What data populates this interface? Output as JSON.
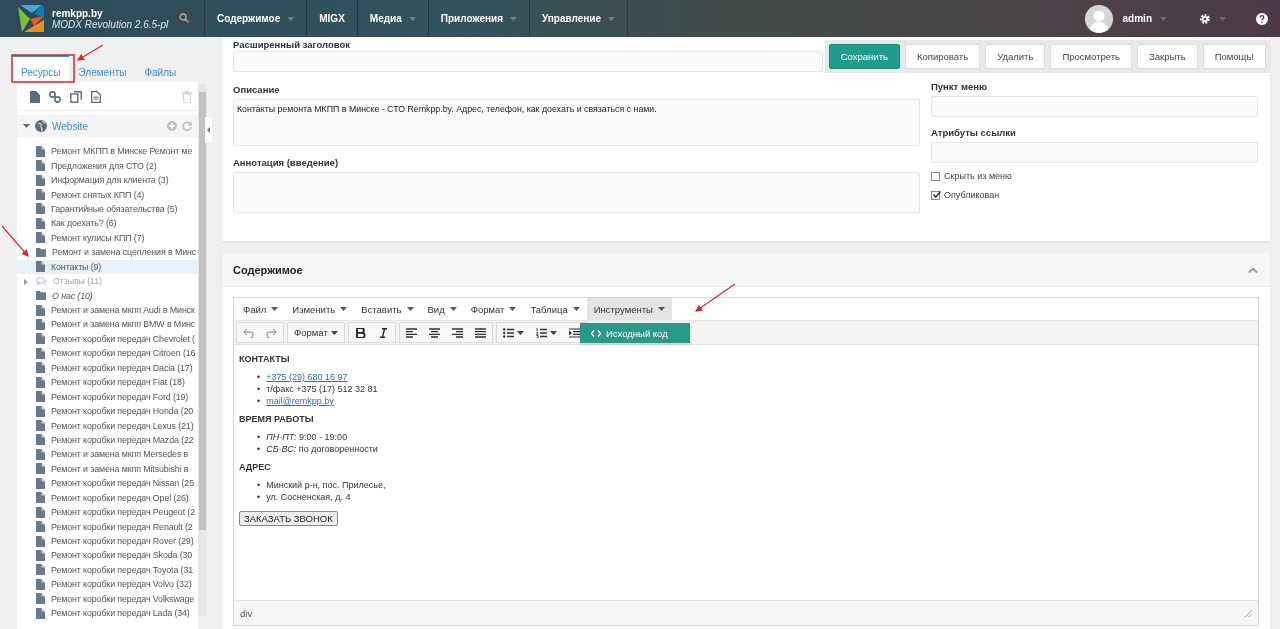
{
  "topbar": {
    "site_name": "remkpp.by",
    "version": "MODX Revolution 2.6.5-pl",
    "user": "admin",
    "nav": [
      {
        "label": "Содержимое",
        "has_menu": true
      },
      {
        "label": "MIGX",
        "has_menu": false
      },
      {
        "label": "Медиа",
        "has_menu": true
      },
      {
        "label": "Приложения",
        "has_menu": true
      },
      {
        "label": "Управление",
        "has_menu": true
      }
    ]
  },
  "sidebar": {
    "tabs": [
      {
        "label": "Ресурсы",
        "selected": true
      },
      {
        "label": "Элементы",
        "selected": false
      },
      {
        "label": "Файлы",
        "selected": false
      }
    ],
    "root": "Website",
    "items": [
      {
        "label": "Ремонт МКПП в Минске Ремонт ме",
        "kind": "document",
        "selected": false,
        "published": true,
        "hidden_from_menu": false,
        "expandable": false
      },
      {
        "label": "Предложения для СТО (2)",
        "kind": "document",
        "selected": false,
        "published": true,
        "hidden_from_menu": false,
        "expandable": false
      },
      {
        "label": "Информация для клиента (3)",
        "kind": "document",
        "selected": false,
        "published": true,
        "hidden_from_menu": false,
        "expandable": false
      },
      {
        "label": "Ремонт снятых КПП (4)",
        "kind": "document",
        "selected": false,
        "published": true,
        "hidden_from_menu": false,
        "expandable": false
      },
      {
        "label": "Гарантийные обязательства (5)",
        "kind": "document",
        "selected": false,
        "published": true,
        "hidden_from_menu": false,
        "expandable": false
      },
      {
        "label": "Как доехать? (6)",
        "kind": "document",
        "selected": false,
        "published": true,
        "hidden_from_menu": false,
        "expandable": false
      },
      {
        "label": "Ремонт кулисы КПП (7)",
        "kind": "document",
        "selected": false,
        "published": true,
        "hidden_from_menu": false,
        "expandable": false
      },
      {
        "label": "Ремонт и замена сцепления в Минс",
        "kind": "folder",
        "selected": false,
        "published": true,
        "hidden_from_menu": false,
        "expandable": false
      },
      {
        "label": "Контакты (9)",
        "kind": "document",
        "selected": true,
        "published": true,
        "hidden_from_menu": false,
        "expandable": false
      },
      {
        "label": "Отзывы (11)",
        "kind": "comments",
        "selected": false,
        "published": false,
        "hidden_from_menu": false,
        "expandable": true
      },
      {
        "label": "О нас (10)",
        "kind": "folder",
        "selected": false,
        "published": true,
        "hidden_from_menu": true,
        "expandable": false
      },
      {
        "label": "Ремонт и замена мкпп Audi в Минск",
        "kind": "document",
        "selected": false,
        "published": true,
        "hidden_from_menu": false,
        "expandable": false
      },
      {
        "label": "Ремонт и замена мкпп BMW в Минс",
        "kind": "document",
        "selected": false,
        "published": true,
        "hidden_from_menu": false,
        "expandable": false
      },
      {
        "label": "Ремонт коробки передач Chevrolet (",
        "kind": "document",
        "selected": false,
        "published": true,
        "hidden_from_menu": false,
        "expandable": false
      },
      {
        "label": "Ремонт коробки передач Citroen (16",
        "kind": "document",
        "selected": false,
        "published": true,
        "hidden_from_menu": false,
        "expandable": false
      },
      {
        "label": "Ремонт коробки передач Dacia (17)",
        "kind": "document",
        "selected": false,
        "published": true,
        "hidden_from_menu": false,
        "expandable": false
      },
      {
        "label": "Ремонт коробки передач Fiat (18)",
        "kind": "document",
        "selected": false,
        "published": true,
        "hidden_from_menu": false,
        "expandable": false
      },
      {
        "label": "Ремонт коробки передач Ford (19)",
        "kind": "document",
        "selected": false,
        "published": true,
        "hidden_from_menu": false,
        "expandable": false
      },
      {
        "label": "Ремонт коробки передач Honda (20",
        "kind": "document",
        "selected": false,
        "published": true,
        "hidden_from_menu": false,
        "expandable": false
      },
      {
        "label": "Ремонт коробки передач Lexus (21)",
        "kind": "document",
        "selected": false,
        "published": true,
        "hidden_from_menu": false,
        "expandable": false
      },
      {
        "label": "Ремонт коробки передач Mazda (22",
        "kind": "document",
        "selected": false,
        "published": true,
        "hidden_from_menu": false,
        "expandable": false
      },
      {
        "label": "Ремонт и замена мкпп Mersedes в",
        "kind": "document",
        "selected": false,
        "published": true,
        "hidden_from_menu": false,
        "expandable": false
      },
      {
        "label": "Ремонт и замена мкпп Mitsubishi в",
        "kind": "document",
        "selected": false,
        "published": true,
        "hidden_from_menu": false,
        "expandable": false
      },
      {
        "label": "Ремонт коробки передач Nissan (25",
        "kind": "document",
        "selected": false,
        "published": true,
        "hidden_from_menu": false,
        "expandable": false
      },
      {
        "label": "Ремонт коробки передач Opel (26)",
        "kind": "document",
        "selected": false,
        "published": true,
        "hidden_from_menu": false,
        "expandable": false
      },
      {
        "label": "Ремонт коробки передач Peugeot (2",
        "kind": "document",
        "selected": false,
        "published": true,
        "hidden_from_menu": false,
        "expandable": false
      },
      {
        "label": "Ремонт коробки передач Renault (2",
        "kind": "document",
        "selected": false,
        "published": true,
        "hidden_from_menu": false,
        "expandable": false
      },
      {
        "label": "Ремонт коробки передач Rover (29)",
        "kind": "document",
        "selected": false,
        "published": true,
        "hidden_from_menu": false,
        "expandable": false
      },
      {
        "label": "Ремонт коробки передач Skoda (30",
        "kind": "document",
        "selected": false,
        "published": true,
        "hidden_from_menu": false,
        "expandable": false
      },
      {
        "label": "Ремонт коробки передач Toyota (31",
        "kind": "document",
        "selected": false,
        "published": true,
        "hidden_from_menu": false,
        "expandable": false
      },
      {
        "label": "Ремонт коробки передач Volvo (32)",
        "kind": "document",
        "selected": false,
        "published": true,
        "hidden_from_menu": false,
        "expandable": false
      },
      {
        "label": "Ремонт коробки передач Volkswage",
        "kind": "document",
        "selected": false,
        "published": true,
        "hidden_from_menu": false,
        "expandable": false
      },
      {
        "label": "Ремонт коробки передач Lada (34)",
        "kind": "document",
        "selected": false,
        "published": true,
        "hidden_from_menu": false,
        "expandable": false
      }
    ]
  },
  "actions": [
    {
      "label": "Сохранить",
      "primary": true
    },
    {
      "label": "Копировать",
      "primary": false
    },
    {
      "label": "Удалить",
      "primary": false
    },
    {
      "label": "Просмотреть",
      "primary": false
    },
    {
      "label": "Закрыть",
      "primary": false
    },
    {
      "label": "Помощь!",
      "primary": false
    }
  ],
  "resource_form": {
    "longtitle_label": "Расширенный заголовок",
    "description": {
      "label": "Описание",
      "value": "Контакты ремонта МКПП в Минске - СТО Remkpp.by. Адрес, телефон, как доехать и связаться с нами."
    },
    "introtext": {
      "label": "Аннотация (введение)"
    },
    "menu_title": {
      "label": "Пункт меню"
    },
    "link_attributes": {
      "label": "Атрибуты ссылки"
    },
    "checkboxes": [
      {
        "label": "Скрыть из меню",
        "checked": false
      },
      {
        "label": "Опубликован",
        "checked": true
      }
    ]
  },
  "content_panel": {
    "title": "Содержимое",
    "editor": {
      "menus": [
        {
          "label": "Файл",
          "open": false
        },
        {
          "label": "Изменить",
          "open": false
        },
        {
          "label": "Вставить",
          "open": false
        },
        {
          "label": "Вид",
          "open": false
        },
        {
          "label": "Формат",
          "open": false
        },
        {
          "label": "Таблица",
          "open": false
        },
        {
          "label": "Инструменты",
          "open": true
        }
      ],
      "format_button": "Формат",
      "dropdown_items": [
        {
          "label": "Исходный код",
          "highlighted": true
        }
      ],
      "body": [
        {
          "kind": "heading",
          "text": "КОНТАКТЫ"
        },
        {
          "kind": "list",
          "marker": "•",
          "items": [
            {
              "kind": "link",
              "text": "+375 (29) 680 16 97"
            },
            {
              "kind": "text",
              "text": "т/факс +375 (17) 512 32 81"
            },
            {
              "kind": "link",
              "text": "mail@remkpp.by"
            }
          ]
        },
        {
          "kind": "heading",
          "text": "ВРЕМЯ РАБОТЫ"
        },
        {
          "kind": "list",
          "marker": "•",
          "items": [
            {
              "kind": "text",
              "text": "*ПН-ПТ:* 9:00 - 19:00"
            },
            {
              "kind": "text",
              "text": "*СБ-ВС:* по договоренности"
            }
          ]
        },
        {
          "kind": "heading",
          "text": "АДРЕС"
        },
        {
          "kind": "list",
          "marker": "•",
          "items": [
            {
              "kind": "text",
              "text": "Минский р-н, пос. Прилесье,"
            },
            {
              "kind": "text",
              "text": "ул. Сосненская, д. 4"
            }
          ]
        },
        {
          "kind": "button",
          "text": "ЗАКАЗАТЬ ЗВОНОК"
        }
      ],
      "path": "div"
    }
  }
}
